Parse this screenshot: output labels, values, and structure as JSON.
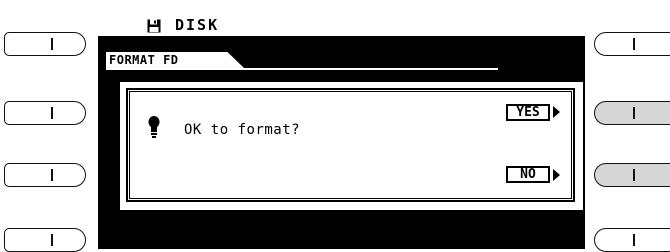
{
  "screen": {
    "title": "DISK",
    "title_icon": "floppy-disk-icon",
    "tab_label": "FORMAT FD"
  },
  "dialog": {
    "icon": "lightbulb-icon",
    "message": "OK to format?",
    "options": [
      {
        "label": "YES",
        "selected": true
      },
      {
        "label": "NO",
        "selected": true
      }
    ]
  },
  "hardware_buttons": {
    "left": [
      {
        "active": false
      },
      {
        "active": false
      },
      {
        "active": false
      },
      {
        "active": false
      }
    ],
    "right": [
      {
        "active": false
      },
      {
        "active": true
      },
      {
        "active": true
      },
      {
        "active": false
      }
    ]
  },
  "colors": {
    "lcd_dark": "#000000",
    "lcd_light": "#ffffff",
    "button_active": "#d6d6d6"
  }
}
